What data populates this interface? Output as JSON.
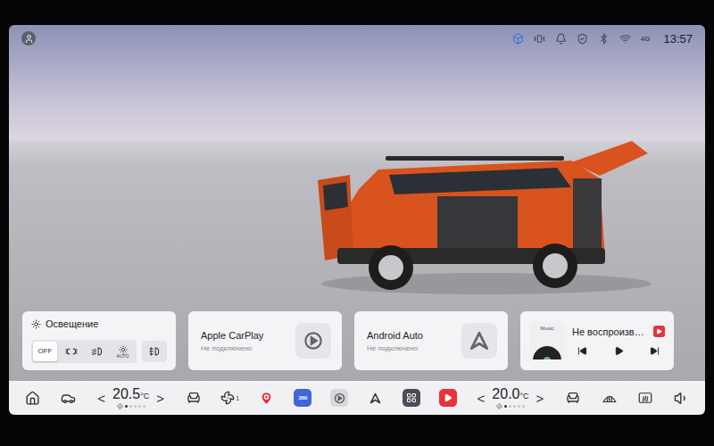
{
  "status_bar": {
    "network": "4G",
    "time": "13:57"
  },
  "lighting": {
    "title": "Освещение",
    "modes": [
      {
        "kind": "off",
        "label": "OFF",
        "selected": true
      },
      {
        "kind": "parking",
        "selected": false
      },
      {
        "kind": "low-beam",
        "selected": false
      },
      {
        "kind": "auto",
        "label": "AUTO",
        "selected": false
      }
    ],
    "fog_light": {
      "on": false
    }
  },
  "projection": [
    {
      "kind": "carplay",
      "title": "Apple CarPlay",
      "status": "Не подключено"
    },
    {
      "kind": "android",
      "title": "Android Auto",
      "status": "Не подключено"
    }
  ],
  "media": {
    "cover_label": "Music",
    "title": "Не воспроизв…",
    "playing": false
  },
  "dock": {
    "left_climate": {
      "prev": "<",
      "temp": "20.5",
      "unit": "°C",
      "next": ">",
      "fan_level": 0.2
    },
    "fan_speed": "1",
    "view_360": "360",
    "right_climate": {
      "prev": "<",
      "temp": "20.0",
      "unit": "°C",
      "next": ">",
      "fan_level": 0.2
    }
  }
}
